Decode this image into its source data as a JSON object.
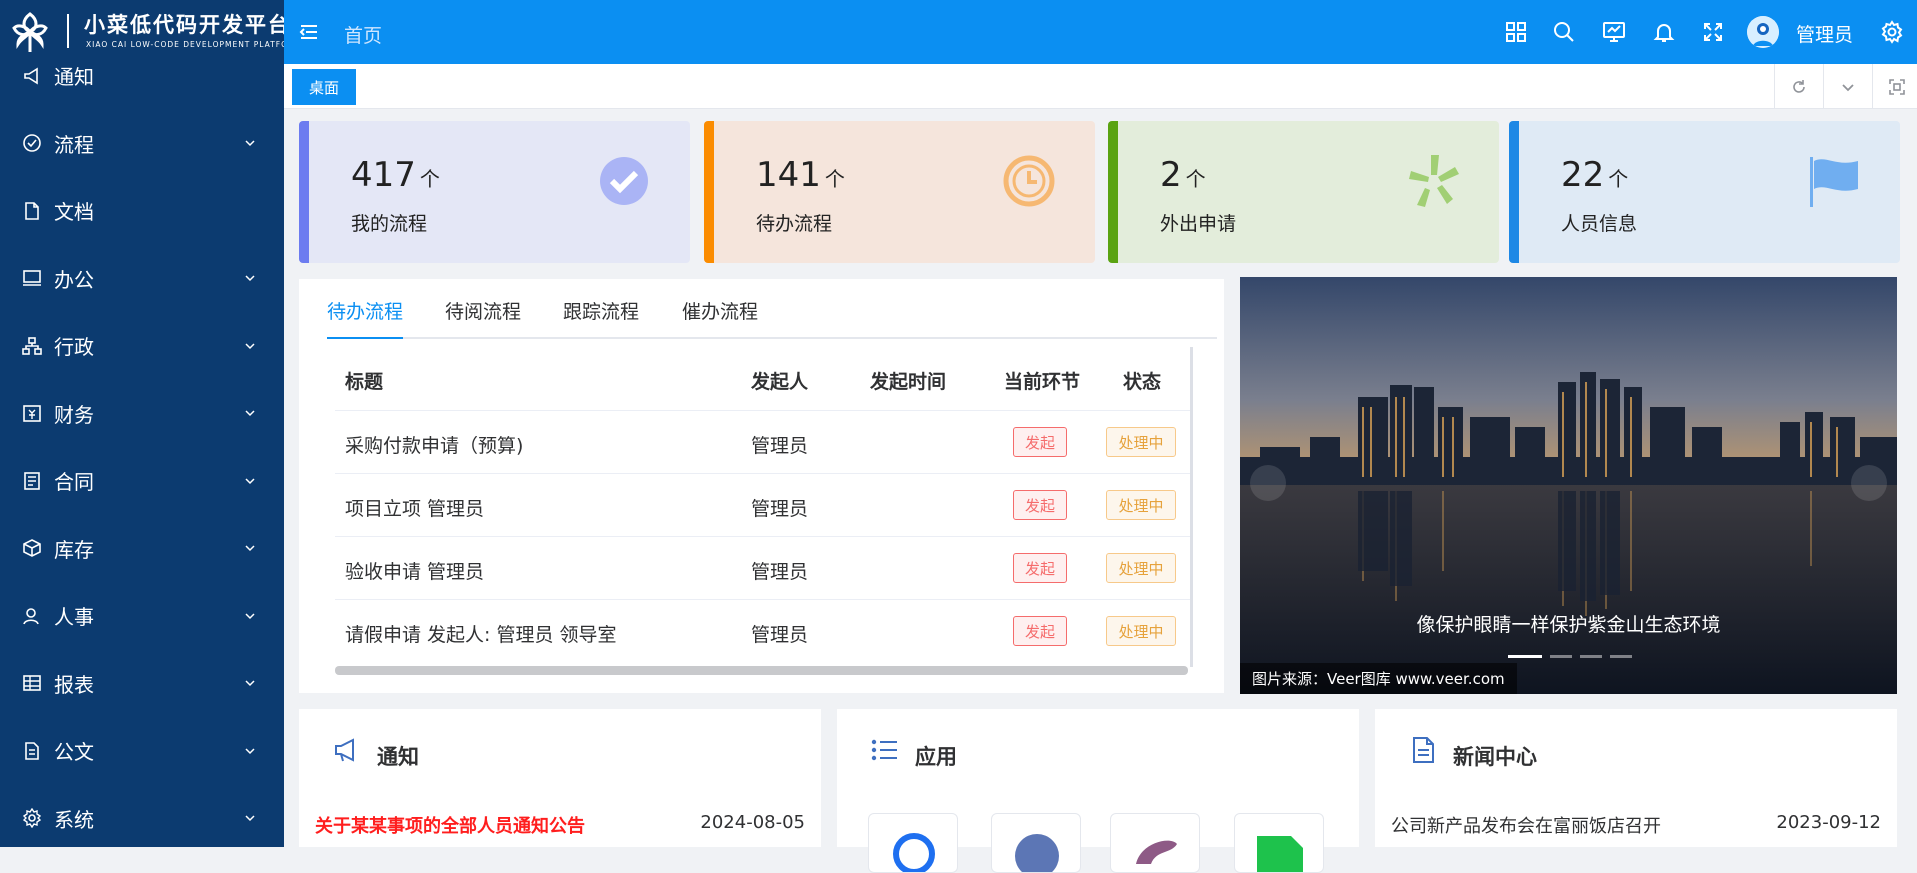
{
  "brand": {
    "title": "小菜低代码开发平台",
    "subtitle": "XIAO CAI LOW-CODE DEVELOPMENT PLATFORM"
  },
  "sidebar": {
    "items": [
      {
        "label": "通知",
        "icon": "notification-icon",
        "expandable": false
      },
      {
        "label": "流程",
        "icon": "check-circle-icon",
        "expandable": true
      },
      {
        "label": "文档",
        "icon": "document-icon",
        "expandable": false
      },
      {
        "label": "办公",
        "icon": "monitor-icon",
        "expandable": true
      },
      {
        "label": "行政",
        "icon": "org-chart-icon",
        "expandable": true
      },
      {
        "label": "财务",
        "icon": "finance-icon",
        "expandable": true
      },
      {
        "label": "合同",
        "icon": "contract-icon",
        "expandable": true
      },
      {
        "label": "库存",
        "icon": "box-icon",
        "expandable": true
      },
      {
        "label": "人事",
        "icon": "person-icon",
        "expandable": true
      },
      {
        "label": "报表",
        "icon": "table-icon",
        "expandable": true
      },
      {
        "label": "公文",
        "icon": "official-doc-icon",
        "expandable": true
      },
      {
        "label": "系统",
        "icon": "gear-icon",
        "expandable": true
      }
    ]
  },
  "header": {
    "breadcrumb_home": "首页",
    "username": "管理员",
    "icons": [
      "grid-icon",
      "search-icon",
      "screen-icon",
      "bell-icon",
      "fullscreen-icon",
      "settings-icon"
    ]
  },
  "tabs": {
    "active": "桌面"
  },
  "stats": [
    {
      "value": "417",
      "unit": "个",
      "label": "我的流程",
      "color": "#6c7cf0",
      "bg": "#e4e7f6",
      "icon": "check-badge-icon",
      "icon_color": "#aab4f5"
    },
    {
      "value": "141",
      "unit": "个",
      "label": "待办流程",
      "color": "#fb8c00",
      "bg": "#f5e5dc",
      "icon": "clock-icon",
      "icon_color": "#f6b872"
    },
    {
      "value": "2",
      "unit": "个",
      "label": "外出申请",
      "color": "#5aa312",
      "bg": "#e3eddb",
      "icon": "pinwheel-icon",
      "icon_color": "#a1cf74"
    },
    {
      "value": "22",
      "unit": "个",
      "label": "人员信息",
      "color": "#1e88e5",
      "bg": "#dfeaf5",
      "icon": "flag-icon",
      "icon_color": "#70aef0"
    }
  ],
  "flow": {
    "tabs": [
      "待办流程",
      "待阅流程",
      "跟踪流程",
      "催办流程"
    ],
    "columns": [
      "标题",
      "发起人",
      "发起时间",
      "当前环节",
      "状态"
    ],
    "rows": [
      {
        "title": "采购付款申请（预算)",
        "initiator": "管理员",
        "time": "",
        "step": "发起",
        "status": "处理中"
      },
      {
        "title": "项目立项 管理员",
        "initiator": "管理员",
        "time": "",
        "step": "发起",
        "status": "处理中"
      },
      {
        "title": "验收申请 管理员",
        "initiator": "管理员",
        "time": "",
        "step": "发起",
        "status": "处理中"
      },
      {
        "title": "请假申请 发起人: 管理员 领导室",
        "initiator": "管理员",
        "time": "",
        "step": "发起",
        "status": "处理中"
      }
    ]
  },
  "carousel": {
    "caption": "像保护眼睛一样保护紫金山生态环境",
    "source": "图片来源：Veer图库 www.veer.com",
    "slides": 4,
    "active": 0
  },
  "notice": {
    "title": "通知",
    "items": [
      {
        "title": "关于某某事项的全部人员通知公告",
        "date": "2024-08-05"
      }
    ]
  },
  "apps": {
    "title": "应用"
  },
  "news": {
    "title": "新闻中心",
    "items": [
      {
        "title": "公司新产品发布会在富丽饭店召开",
        "date": "2023-09-12"
      }
    ]
  }
}
